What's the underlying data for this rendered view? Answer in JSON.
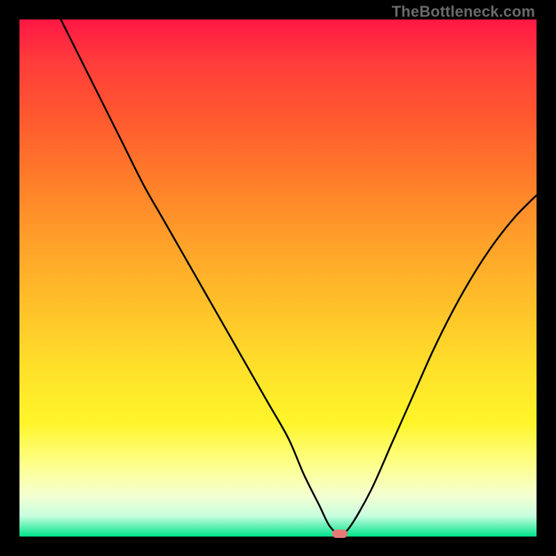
{
  "watermark": "TheBottleneck.com",
  "chart_data": {
    "type": "line",
    "title": "",
    "xlabel": "",
    "ylabel": "",
    "xlim": [
      0,
      100
    ],
    "ylim": [
      0,
      100
    ],
    "grid": false,
    "legend": false,
    "series": [
      {
        "name": "bottleneck-curve",
        "x": [
          8,
          12,
          16,
          20,
          24,
          28,
          32,
          36,
          40,
          44,
          48,
          52,
          55,
          58,
          60,
          62,
          64,
          68,
          72,
          76,
          80,
          84,
          88,
          92,
          96,
          100
        ],
        "y": [
          100,
          92,
          84,
          76,
          68,
          61,
          54,
          47,
          40,
          33,
          26,
          19,
          12,
          6,
          2,
          0.5,
          2,
          9,
          18,
          27,
          36,
          44,
          51,
          57,
          62,
          66
        ]
      }
    ],
    "annotations": [
      {
        "name": "min-marker",
        "x": 62,
        "y": 0.5,
        "shape": "pill",
        "color": "#e77a77"
      }
    ],
    "background_gradient": {
      "direction": "vertical",
      "stops": [
        {
          "pos": 0.0,
          "color": "#ff1744"
        },
        {
          "pos": 0.3,
          "color": "#ff7a2a"
        },
        {
          "pos": 0.68,
          "color": "#ffe12a"
        },
        {
          "pos": 0.92,
          "color": "#f4ffd0"
        },
        {
          "pos": 1.0,
          "color": "#00e38a"
        }
      ]
    }
  }
}
